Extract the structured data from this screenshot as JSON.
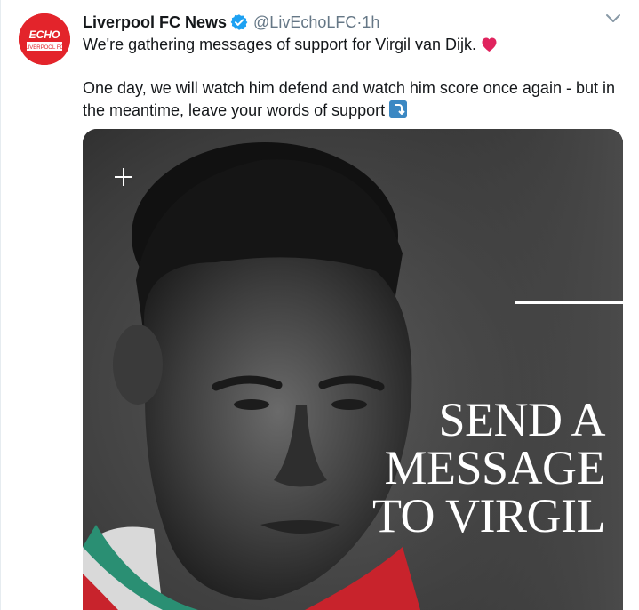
{
  "tweet": {
    "avatar": {
      "logo_text_top": "ECHO",
      "logo_text_bottom": "LIVERPOOL FC",
      "bg_color": "#e3242b"
    },
    "display_name": "Liverpool FC News",
    "verified_icon": "verified-badge-icon",
    "handle": "@LivEchoLFC",
    "separator": "·",
    "time": "1h",
    "menu_icon": "chevron-down-icon",
    "text_line1": "We're gathering messages of support for Virgil van Dijk.",
    "emoji_heart": "red-heart-icon",
    "text_line2": "One day, we will watch him defend and watch him score once again - but in the meantime, leave your words of support",
    "emoji_arrow": "arrow-curving-down-icon",
    "media": {
      "overlay_line1": "SEND A",
      "overlay_line2": "MESSAGE",
      "overlay_line3": "TO VIRGIL",
      "plus_icon": "plus-icon"
    }
  },
  "colors": {
    "name": "#14171a",
    "meta": "#657786",
    "verified": "#1da1f2",
    "heart": "#e0245e",
    "arrow_emoji_bg": "#3b88c3"
  }
}
